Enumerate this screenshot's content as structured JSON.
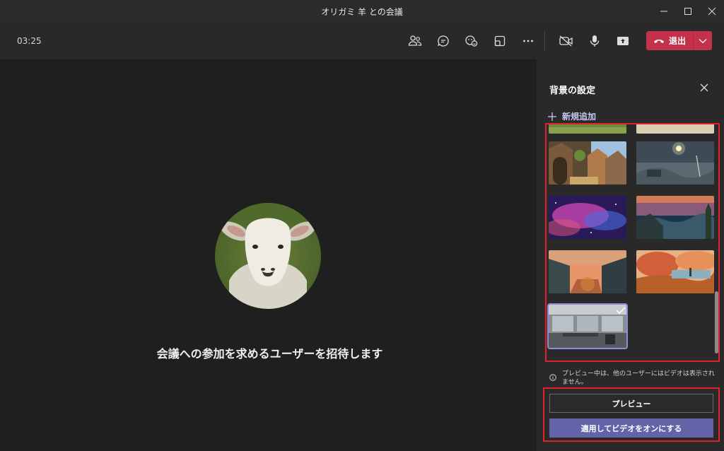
{
  "window": {
    "title": "オリガミ 羊 との会議"
  },
  "toolbar": {
    "timer": "03:25",
    "icons": [
      "participants-icon",
      "chat-icon",
      "reactions-icon",
      "rooms-icon",
      "more-icon"
    ],
    "media_icons": [
      "camera-off-icon",
      "mic-icon",
      "share-icon"
    ],
    "leave_label": "退出"
  },
  "stage": {
    "invite_text": "会議への参加を求めるユーザーを招待します"
  },
  "panel": {
    "title": "背景の設定",
    "add_new_label": "新規追加",
    "notice_text": "プレビュー中は、他のユーザーにはビデオは表示されません。",
    "preview_button": "プレビュー",
    "apply_button": "適用してビデオをオンにする",
    "thumbnails": [
      "forest",
      "sand",
      "fantasy-town",
      "space-station",
      "nebula",
      "coast-night",
      "autumn-street",
      "autumn-cliff",
      "office"
    ],
    "selected_thumbnail": "office"
  }
}
